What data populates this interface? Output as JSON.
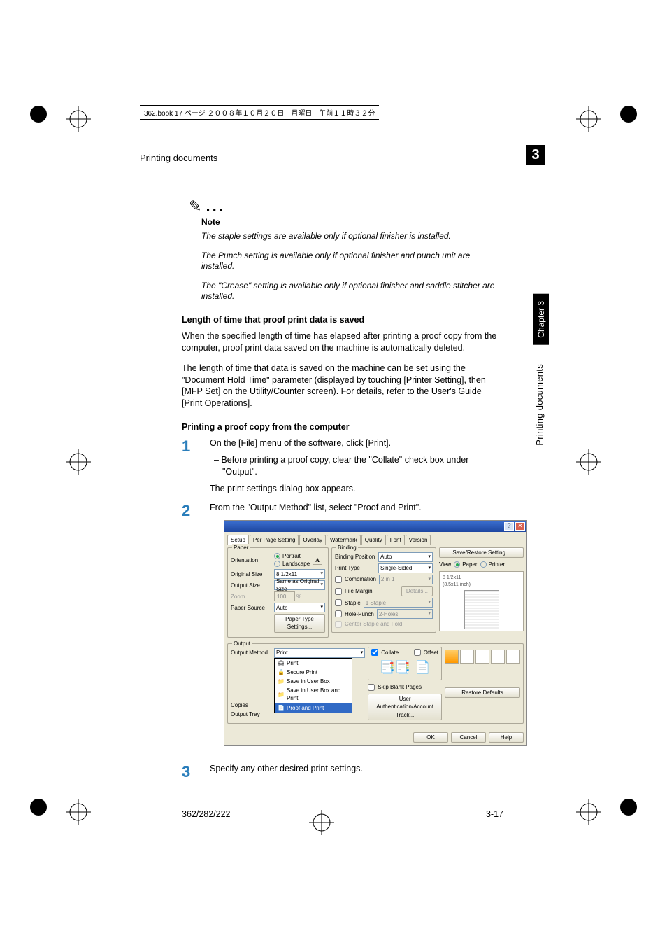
{
  "header_bar": "362.book  17 ページ  ２００８年１０月２０日　月曜日　午前１１時３２分",
  "section_title": "Printing documents",
  "chapter_number": "3",
  "side_text": "Printing documents",
  "side_chapter": "Chapter 3",
  "note": {
    "label": "Note",
    "lines": [
      "The staple settings are available only if optional finisher is installed.",
      "The Punch setting is available only if optional finisher and punch unit are installed.",
      "The \"Crease\" setting is available only if optional finisher and saddle stitcher are installed."
    ]
  },
  "h1": "Length of time that proof print data is saved",
  "p1": "When the specified length of time has elapsed after printing a proof copy from the computer, proof print data saved on the machine is automatically deleted.",
  "p2": "The length of time that data is saved on the machine can be set using the \"Document Hold Time\" parameter (displayed by touching [Printer Setting], then [MFP Set] on the Utility/Counter screen). For details, refer to the User's Guide [Print Operations].",
  "h2": "Printing a proof copy from the computer",
  "steps": {
    "s1": {
      "num": "1",
      "text": "On the [File] menu of the software, click [Print].",
      "sub": "Before printing a proof copy, clear the \"Collate\" check box under \"Output\".",
      "after": "The print settings dialog box appears."
    },
    "s2": {
      "num": "2",
      "text": "From the \"Output Method\" list, select \"Proof and Print\"."
    },
    "s3": {
      "num": "3",
      "text": "Specify any other desired print settings."
    }
  },
  "dialog": {
    "tabs": [
      "Setup",
      "Per Page Setting",
      "Overlay",
      "Watermark",
      "Quality",
      "Font",
      "Version"
    ],
    "paper": {
      "title": "Paper",
      "orientation": "Orientation",
      "portrait": "Portrait",
      "landscape": "Landscape",
      "original_size": "Original Size",
      "original_size_val": "8 1/2x11",
      "output_size": "Output Size",
      "output_size_val": "Same as Original Size",
      "zoom": "Zoom",
      "zoom_val": "100",
      "paper_source": "Paper Source",
      "paper_source_val": "Auto",
      "paper_type_btn": "Paper Type Settings..."
    },
    "binding": {
      "title": "Binding",
      "binding_position": "Binding Position",
      "binding_position_val": "Auto",
      "print_type": "Print Type",
      "print_type_val": "Single-Sided",
      "combination": "Combination",
      "combination_val": "2 in 1",
      "file_margin": "File Margin",
      "details": "Details...",
      "staple": "Staple",
      "staple_val": "1 Staple",
      "hole_punch": "Hole-Punch",
      "hole_punch_val": "2-Holes",
      "center": "Center Staple and Fold"
    },
    "right": {
      "save_restore": "Save/Restore Setting...",
      "view": "View",
      "paper": "Paper",
      "printer": "Printer",
      "preview_text": "8 1/2x11\n(8.5x11 inch)"
    },
    "output": {
      "title": "Output",
      "method": "Output Method",
      "method_val": "Print",
      "options": [
        "Print",
        "Secure Print",
        "Save in User Box",
        "Save in User Box and Print",
        "Proof and Print"
      ],
      "copies": "Copies",
      "tray": "Output Tray",
      "collate": "Collate",
      "offset": "Offset",
      "skip": "Skip Blank Pages",
      "auth": "User Authentication/Account Track...",
      "restore": "Restore Defaults"
    },
    "buttons": {
      "ok": "OK",
      "cancel": "Cancel",
      "help": "Help"
    }
  },
  "footer": {
    "left": "362/282/222",
    "right": "3-17"
  }
}
